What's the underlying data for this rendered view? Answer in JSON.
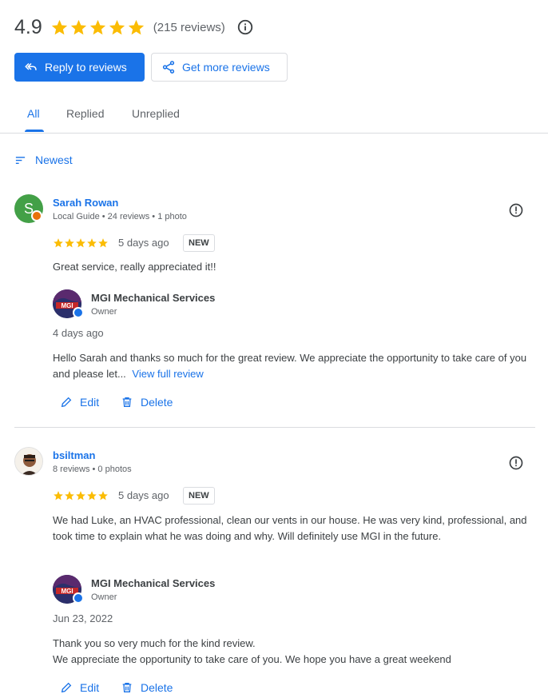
{
  "header": {
    "rating": "4.9",
    "star_count": 5,
    "review_count": "(215 reviews)",
    "info_icon": "info-icon"
  },
  "actions": {
    "reply_label": "Reply to reviews",
    "get_more_label": "Get more reviews"
  },
  "tabs": [
    {
      "label": "All",
      "active": true
    },
    {
      "label": "Replied",
      "active": false
    },
    {
      "label": "Unreplied",
      "active": false
    }
  ],
  "sort": {
    "label": "Newest"
  },
  "reviews": [
    {
      "name": "Sarah Rowan",
      "avatar_letter": "S",
      "meta": "Local Guide • 24 reviews • 1 photo",
      "stars": 5,
      "date": "5 days ago",
      "badge": "NEW",
      "text": "Great service, really appreciated it!!",
      "reply": {
        "owner_name": "MGI Mechanical Services",
        "owner_role": "Owner",
        "date": "4 days ago",
        "text": "Hello Sarah and thanks so much for the great review. We appreciate the opportunity to take care of you and please let...",
        "more_link": "View full review"
      },
      "edit_label": "Edit",
      "delete_label": "Delete"
    },
    {
      "name": "bsiltman",
      "meta": "8 reviews • 0 photos",
      "stars": 5,
      "date": "5 days ago",
      "badge": "NEW",
      "text": "We had Luke, an HVAC professional, clean our vents in our house. He was very kind, professional, and took time to explain what he was doing and why. Will definitely use MGI in the future.",
      "reply": {
        "owner_name": "MGI Mechanical Services",
        "owner_role": "Owner",
        "date": "Jun 23, 2022",
        "text_line1": "Thank you so very much for the kind review.",
        "text_line2": "We appreciate the opportunity to take care of you. We hope you have a great weekend"
      },
      "edit_label": "Edit",
      "delete_label": "Delete"
    }
  ],
  "colors": {
    "accent": "#1a73e8",
    "star": "#fbbc04",
    "avatar_green": "#43a047",
    "local_guide_orange": "#e8710a"
  }
}
